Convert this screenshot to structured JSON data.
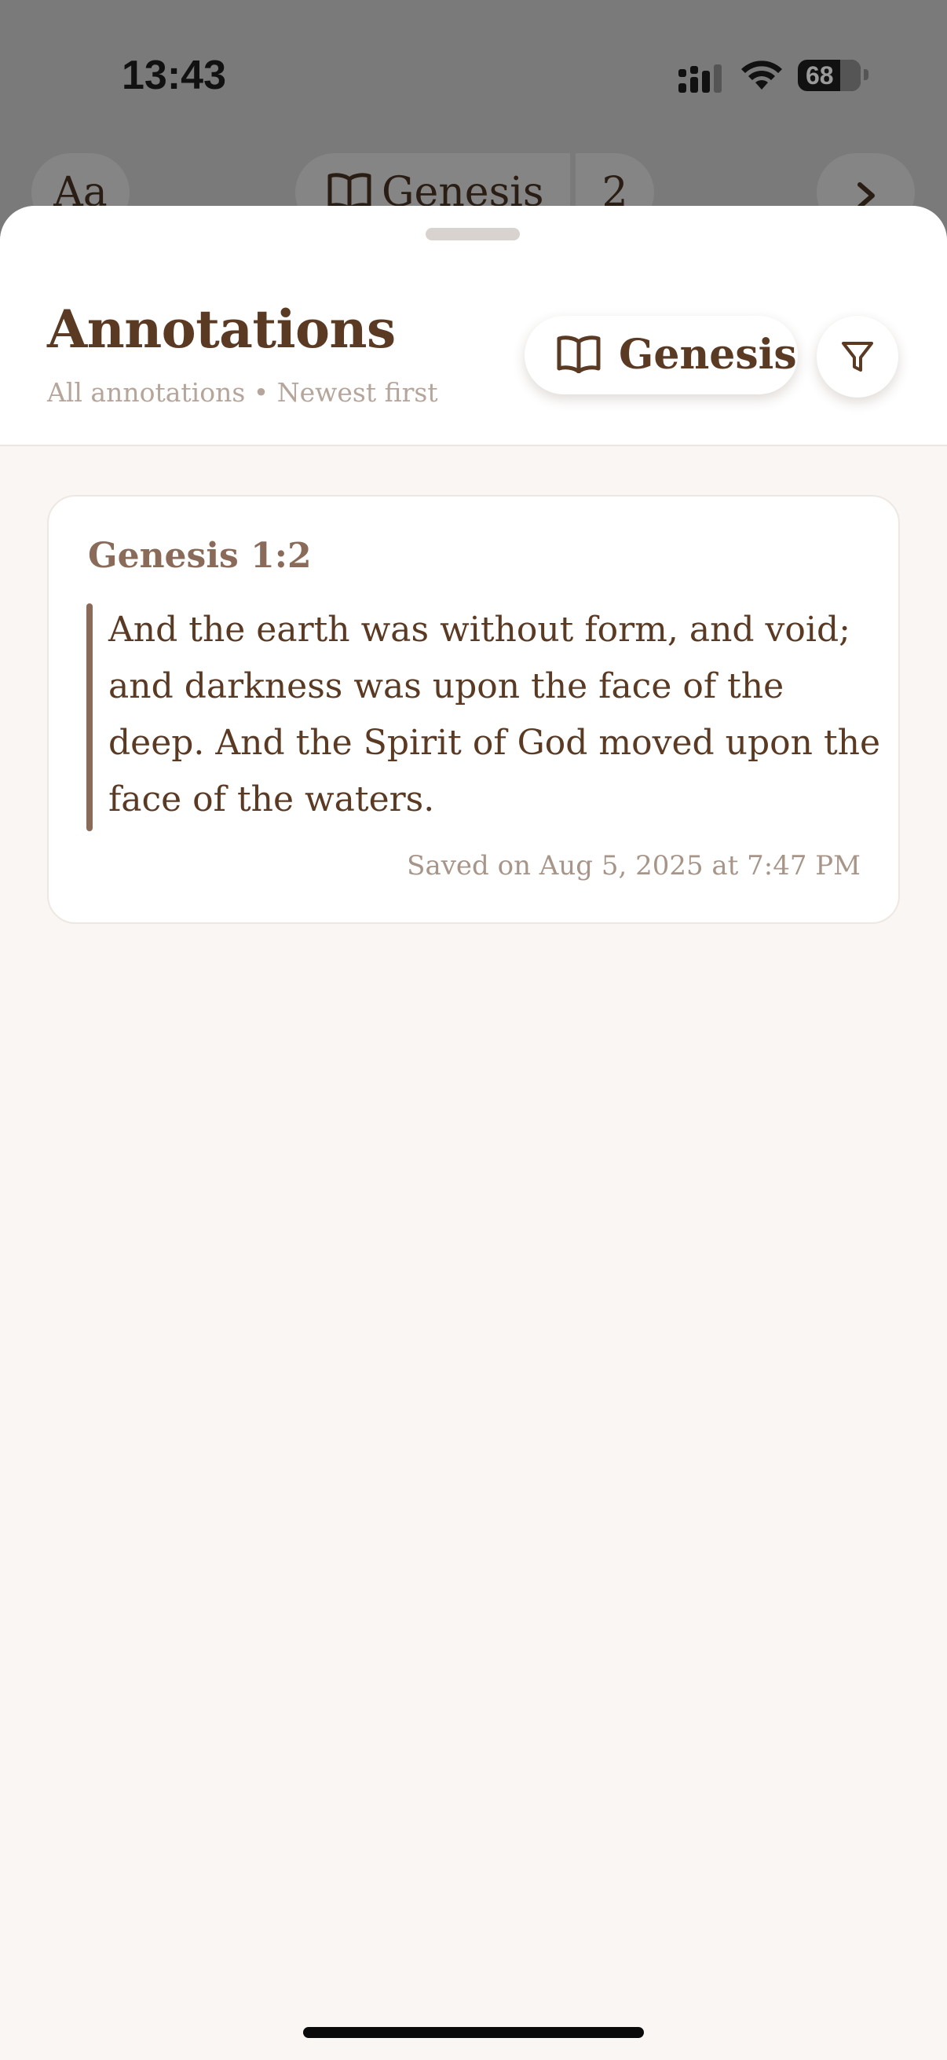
{
  "status_bar": {
    "time": "13:43",
    "battery_level": "68"
  },
  "background_toolbar": {
    "font_button_label": "Aa",
    "book_label": "Genesis",
    "chapter_label": "2",
    "next_icon": "chevron-right-icon"
  },
  "sheet": {
    "title": "Annotations",
    "subtitle": "All annotations • Newest first",
    "book_filter_label": "Genesis",
    "book_filter_icon": "book-icon",
    "filter_icon": "funnel-icon"
  },
  "annotations": [
    {
      "reference": "Genesis 1:2",
      "text": "And the earth was without form, and void; and darkness was upon the face of the deep. And the Spirit of God moved upon the face of the waters.",
      "saved": "Saved on Aug 5, 2025 at 7:47 PM"
    }
  ],
  "colors": {
    "accent_brown": "#5b3a24",
    "muted_brown": "#8a6b5a",
    "sheet_background": "#faf6f3"
  }
}
